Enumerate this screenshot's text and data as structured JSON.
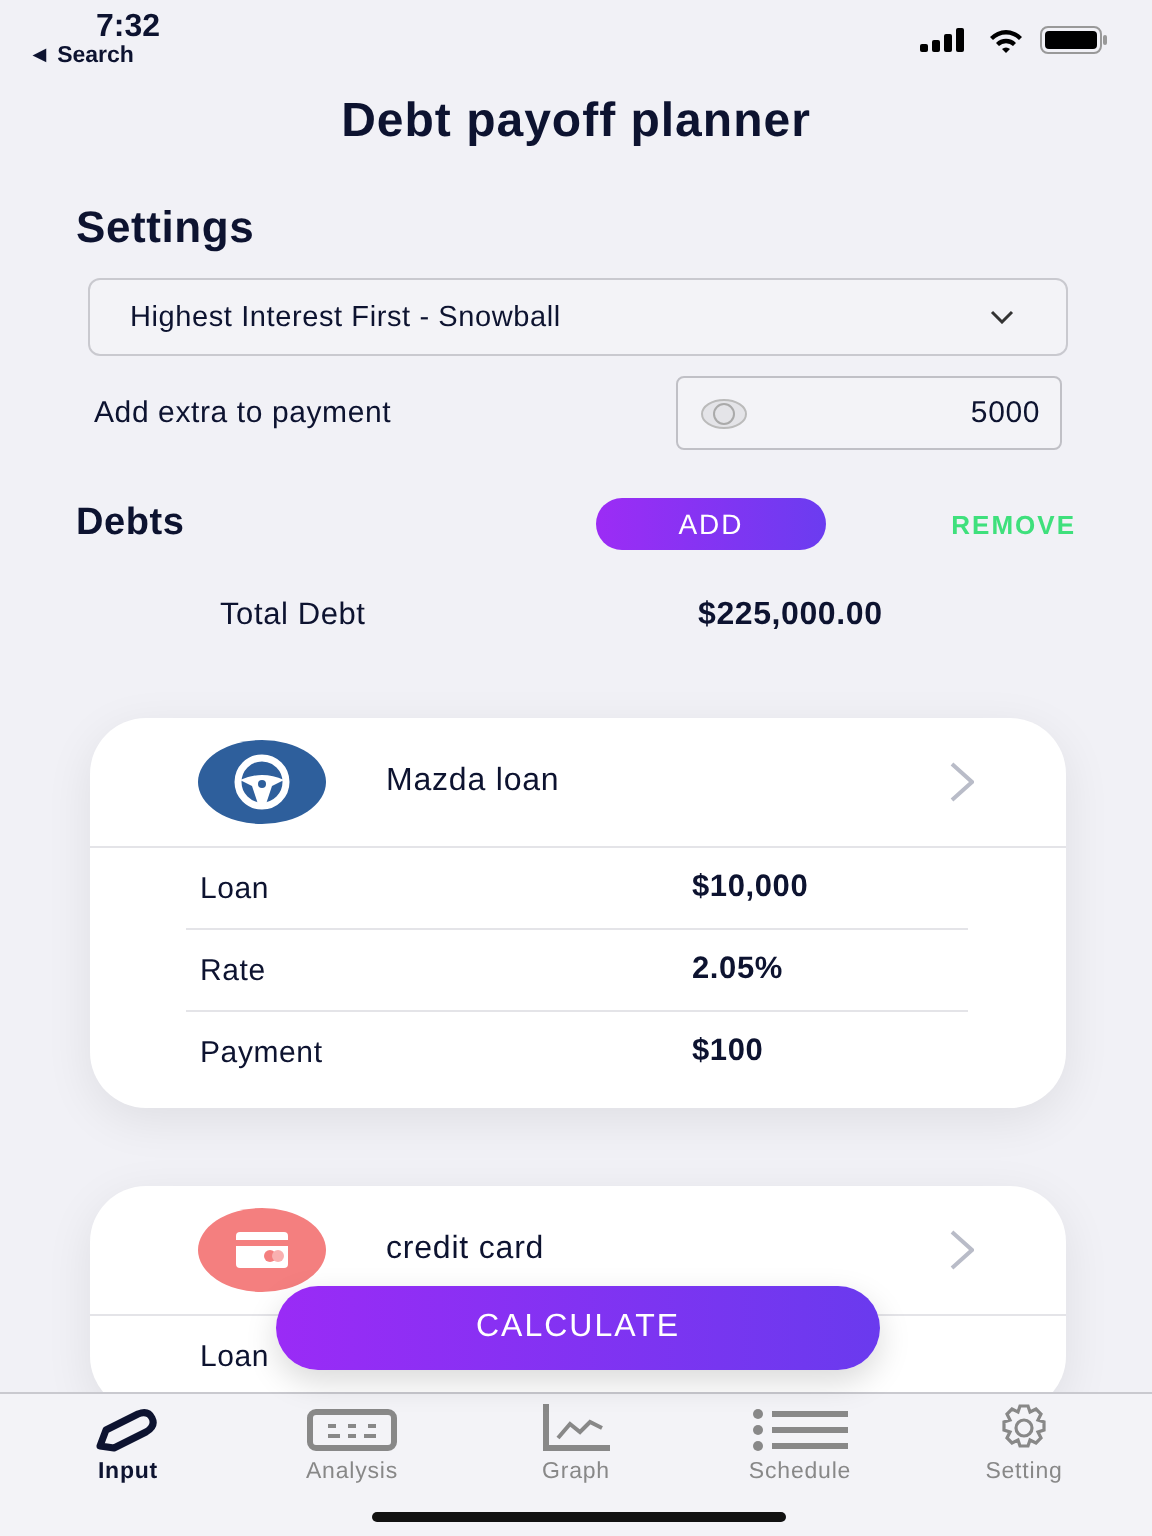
{
  "status_bar": {
    "time": "7:32",
    "back": "◄ Search"
  },
  "title": "Debt payoff planner",
  "settings": {
    "heading": "Settings",
    "strategy": "Highest Interest First - Snowball",
    "extra_label": "Add extra to payment",
    "extra_value": "5000"
  },
  "debts": {
    "heading": "Debts",
    "add": "ADD",
    "remove": "REMOVE",
    "total_label": "Total Debt",
    "total_value": "$225,000.00"
  },
  "cards": [
    {
      "name": "Mazda loan",
      "kind": "steering",
      "color": "#2e5f9c",
      "rows": [
        {
          "label": "Loan",
          "value": "$10,000"
        },
        {
          "label": "Rate",
          "value": "2.05%"
        },
        {
          "label": "Payment",
          "value": "$100"
        }
      ]
    },
    {
      "name": "credit card",
      "kind": "card",
      "color": "#f47f7f",
      "rows": [
        {
          "label": "Loan"
        }
      ]
    }
  ],
  "calculate": "CALCULATE",
  "tabs": [
    {
      "label": "Input",
      "kind": "pencil",
      "selected": true
    },
    {
      "label": "Analysis",
      "kind": "keyboard",
      "selected": false
    },
    {
      "label": "Graph",
      "kind": "graph",
      "selected": false
    },
    {
      "label": "Schedule",
      "kind": "list",
      "selected": false
    },
    {
      "label": "Setting",
      "kind": "gear",
      "selected": false
    }
  ]
}
